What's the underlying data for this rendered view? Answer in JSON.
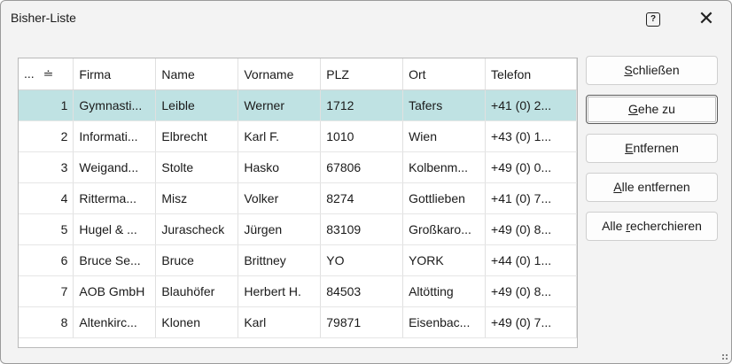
{
  "window": {
    "title": "Bisher-Liste",
    "help_glyph": "?",
    "close_glyph": "✕"
  },
  "table": {
    "columns": [
      "...",
      "Firma",
      "Name",
      "Vorname",
      "PLZ",
      "Ort",
      "Telefon"
    ],
    "sort_glyph": "≐",
    "selected_row": 0,
    "rows": [
      [
        "1",
        "Gymnasti...",
        "Leible",
        "Werner",
        "1712",
        "Tafers",
        "+41 (0) 2..."
      ],
      [
        "2",
        "Informati...",
        "Elbrecht",
        "Karl F.",
        "1010",
        "Wien",
        "+43 (0) 1..."
      ],
      [
        "3",
        "Weigand...",
        "Stolte",
        "Hasko",
        "67806",
        "Kolbenm...",
        "+49 (0) 0..."
      ],
      [
        "4",
        "Ritterma...",
        "Misz",
        "Volker",
        "8274",
        "Gottlieben",
        "+41 (0) 7..."
      ],
      [
        "5",
        "Hugel & ...",
        "Jurascheck",
        "Jürgen",
        "83109",
        "Großkaro...",
        "+49 (0) 8..."
      ],
      [
        "6",
        "Bruce Se...",
        "Bruce",
        "Brittney",
        "YO",
        "YORK",
        "+44 (0) 1..."
      ],
      [
        "7",
        "AOB GmbH",
        "Blauhöfer",
        "Herbert H.",
        "84503",
        "Altötting",
        "+49 (0) 8..."
      ],
      [
        "8",
        "Altenkirc...",
        "Klonen",
        "Karl",
        "79871",
        "Eisenbac...",
        "+49 (0) 7..."
      ]
    ]
  },
  "buttons": [
    {
      "name": "close-button",
      "mnemonic": "S",
      "rest": "chließen"
    },
    {
      "name": "goto-button",
      "mnemonic": "G",
      "rest": "ehe zu"
    },
    {
      "name": "remove-button",
      "mnemonic": "E",
      "rest": "ntfernen"
    },
    {
      "name": "remove-all-button",
      "mnemonic": "A",
      "rest": "lle entfernen"
    },
    {
      "name": "research-all-button",
      "prefix": "Alle ",
      "mnemonic": "r",
      "rest": "echerchieren"
    }
  ]
}
